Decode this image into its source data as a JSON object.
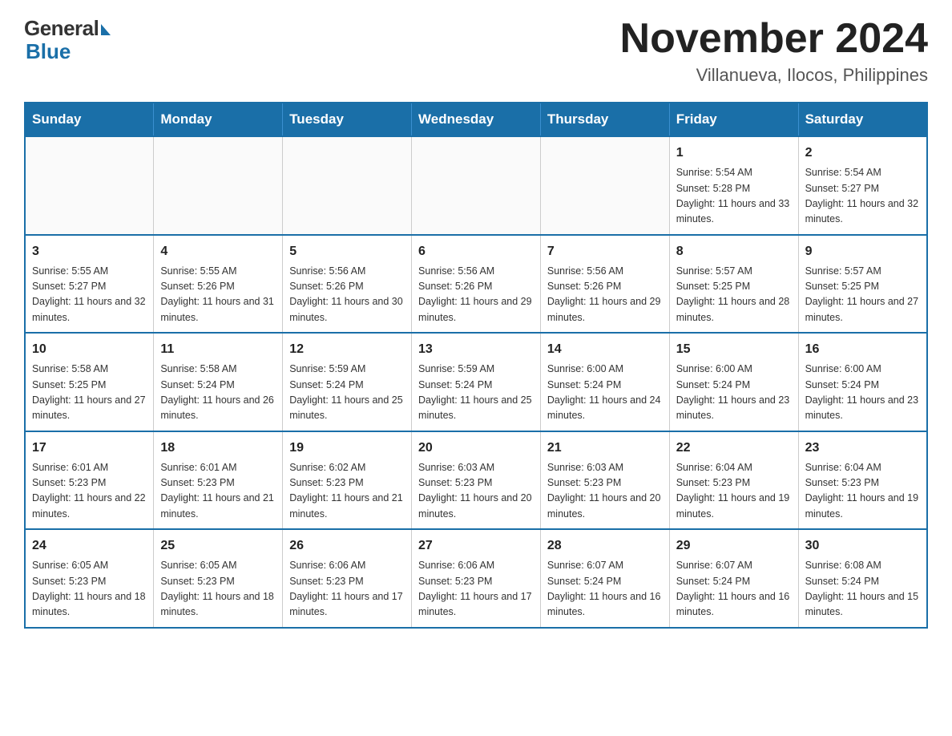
{
  "logo": {
    "general_text": "General",
    "blue_text": "Blue"
  },
  "calendar": {
    "title": "November 2024",
    "subtitle": "Villanueva, Ilocos, Philippines",
    "days_of_week": [
      "Sunday",
      "Monday",
      "Tuesday",
      "Wednesday",
      "Thursday",
      "Friday",
      "Saturday"
    ],
    "weeks": [
      [
        {
          "day": "",
          "info": ""
        },
        {
          "day": "",
          "info": ""
        },
        {
          "day": "",
          "info": ""
        },
        {
          "day": "",
          "info": ""
        },
        {
          "day": "",
          "info": ""
        },
        {
          "day": "1",
          "info": "Sunrise: 5:54 AM\nSunset: 5:28 PM\nDaylight: 11 hours and 33 minutes."
        },
        {
          "day": "2",
          "info": "Sunrise: 5:54 AM\nSunset: 5:27 PM\nDaylight: 11 hours and 32 minutes."
        }
      ],
      [
        {
          "day": "3",
          "info": "Sunrise: 5:55 AM\nSunset: 5:27 PM\nDaylight: 11 hours and 32 minutes."
        },
        {
          "day": "4",
          "info": "Sunrise: 5:55 AM\nSunset: 5:26 PM\nDaylight: 11 hours and 31 minutes."
        },
        {
          "day": "5",
          "info": "Sunrise: 5:56 AM\nSunset: 5:26 PM\nDaylight: 11 hours and 30 minutes."
        },
        {
          "day": "6",
          "info": "Sunrise: 5:56 AM\nSunset: 5:26 PM\nDaylight: 11 hours and 29 minutes."
        },
        {
          "day": "7",
          "info": "Sunrise: 5:56 AM\nSunset: 5:26 PM\nDaylight: 11 hours and 29 minutes."
        },
        {
          "day": "8",
          "info": "Sunrise: 5:57 AM\nSunset: 5:25 PM\nDaylight: 11 hours and 28 minutes."
        },
        {
          "day": "9",
          "info": "Sunrise: 5:57 AM\nSunset: 5:25 PM\nDaylight: 11 hours and 27 minutes."
        }
      ],
      [
        {
          "day": "10",
          "info": "Sunrise: 5:58 AM\nSunset: 5:25 PM\nDaylight: 11 hours and 27 minutes."
        },
        {
          "day": "11",
          "info": "Sunrise: 5:58 AM\nSunset: 5:24 PM\nDaylight: 11 hours and 26 minutes."
        },
        {
          "day": "12",
          "info": "Sunrise: 5:59 AM\nSunset: 5:24 PM\nDaylight: 11 hours and 25 minutes."
        },
        {
          "day": "13",
          "info": "Sunrise: 5:59 AM\nSunset: 5:24 PM\nDaylight: 11 hours and 25 minutes."
        },
        {
          "day": "14",
          "info": "Sunrise: 6:00 AM\nSunset: 5:24 PM\nDaylight: 11 hours and 24 minutes."
        },
        {
          "day": "15",
          "info": "Sunrise: 6:00 AM\nSunset: 5:24 PM\nDaylight: 11 hours and 23 minutes."
        },
        {
          "day": "16",
          "info": "Sunrise: 6:00 AM\nSunset: 5:24 PM\nDaylight: 11 hours and 23 minutes."
        }
      ],
      [
        {
          "day": "17",
          "info": "Sunrise: 6:01 AM\nSunset: 5:23 PM\nDaylight: 11 hours and 22 minutes."
        },
        {
          "day": "18",
          "info": "Sunrise: 6:01 AM\nSunset: 5:23 PM\nDaylight: 11 hours and 21 minutes."
        },
        {
          "day": "19",
          "info": "Sunrise: 6:02 AM\nSunset: 5:23 PM\nDaylight: 11 hours and 21 minutes."
        },
        {
          "day": "20",
          "info": "Sunrise: 6:03 AM\nSunset: 5:23 PM\nDaylight: 11 hours and 20 minutes."
        },
        {
          "day": "21",
          "info": "Sunrise: 6:03 AM\nSunset: 5:23 PM\nDaylight: 11 hours and 20 minutes."
        },
        {
          "day": "22",
          "info": "Sunrise: 6:04 AM\nSunset: 5:23 PM\nDaylight: 11 hours and 19 minutes."
        },
        {
          "day": "23",
          "info": "Sunrise: 6:04 AM\nSunset: 5:23 PM\nDaylight: 11 hours and 19 minutes."
        }
      ],
      [
        {
          "day": "24",
          "info": "Sunrise: 6:05 AM\nSunset: 5:23 PM\nDaylight: 11 hours and 18 minutes."
        },
        {
          "day": "25",
          "info": "Sunrise: 6:05 AM\nSunset: 5:23 PM\nDaylight: 11 hours and 18 minutes."
        },
        {
          "day": "26",
          "info": "Sunrise: 6:06 AM\nSunset: 5:23 PM\nDaylight: 11 hours and 17 minutes."
        },
        {
          "day": "27",
          "info": "Sunrise: 6:06 AM\nSunset: 5:23 PM\nDaylight: 11 hours and 17 minutes."
        },
        {
          "day": "28",
          "info": "Sunrise: 6:07 AM\nSunset: 5:24 PM\nDaylight: 11 hours and 16 minutes."
        },
        {
          "day": "29",
          "info": "Sunrise: 6:07 AM\nSunset: 5:24 PM\nDaylight: 11 hours and 16 minutes."
        },
        {
          "day": "30",
          "info": "Sunrise: 6:08 AM\nSunset: 5:24 PM\nDaylight: 11 hours and 15 minutes."
        }
      ]
    ]
  }
}
